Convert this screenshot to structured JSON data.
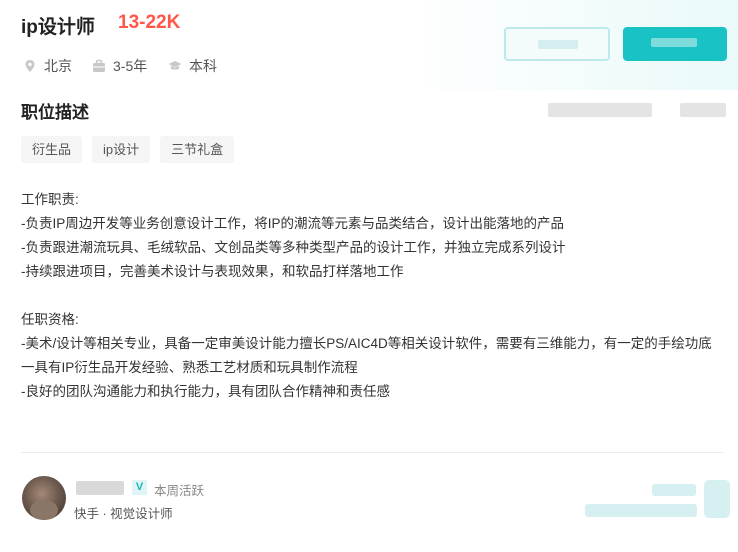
{
  "job": {
    "title": "ip设计师",
    "salary": "13-22K",
    "location": "北京",
    "experience": "3-5年",
    "education": "本科"
  },
  "section": {
    "title": "职位描述"
  },
  "tags": [
    "衍生品",
    "ip设计",
    "三节礼盒"
  ],
  "description": [
    "工作职责:",
    "-负责IP周边开发等业务创意设计工作，将IP的潮流等元素与品类结合，设计出能落地的产品",
    "-负责跟进潮流玩具、毛绒软品、文创品类等多种类型产品的设计工作，并独立完成系列设计",
    "-持续跟进项目，完善美术设计与表现效果，和软品打样落地工作",
    "",
    "任职资格:",
    "-美术/设计等相关专业，具备一定审美设计能力擅长PS/AIC4D等相关设计软件，需要有三维能力，有一定的手绘功底",
    "一具有IP衍生品开发经验、熟悉工艺材质和玩具制作流程",
    "-良好的团队沟通能力和执行能力，具有团队合作精神和责任感"
  ],
  "recruiter": {
    "badge": "V",
    "status": "本周活跃",
    "company_role": "快手 · 视觉设计师"
  },
  "colors": {
    "salary": "#fe574a",
    "accent": "#19c2c4"
  }
}
